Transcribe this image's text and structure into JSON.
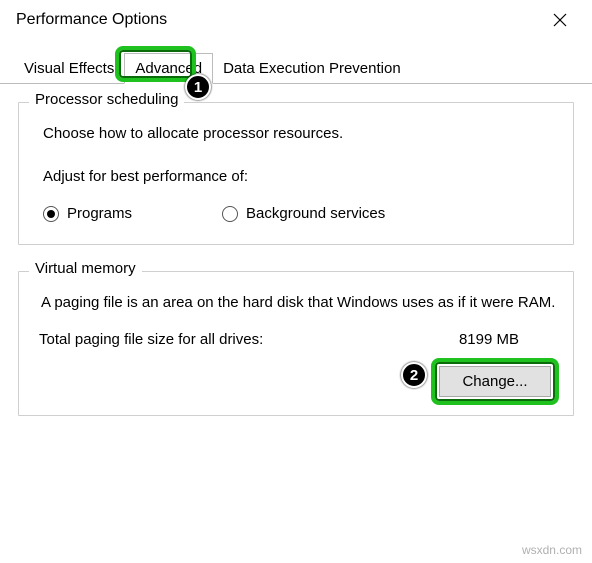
{
  "window": {
    "title": "Performance Options"
  },
  "tabs": {
    "visual_effects": "Visual Effects",
    "advanced": "Advanced",
    "dep": "Data Execution Prevention"
  },
  "callouts": {
    "one": "1",
    "two": "2"
  },
  "processor": {
    "legend": "Processor scheduling",
    "desc": "Choose how to allocate processor resources.",
    "adjust_label": "Adjust for best performance of:",
    "opt_programs": "Programs",
    "opt_background": "Background services"
  },
  "vm": {
    "legend": "Virtual memory",
    "desc": "A paging file is an area on the hard disk that Windows uses as if it were RAM.",
    "total_label": "Total paging file size for all drives:",
    "total_value": "8199 MB",
    "change_btn": "Change..."
  },
  "watermark": "wsxdn.com"
}
